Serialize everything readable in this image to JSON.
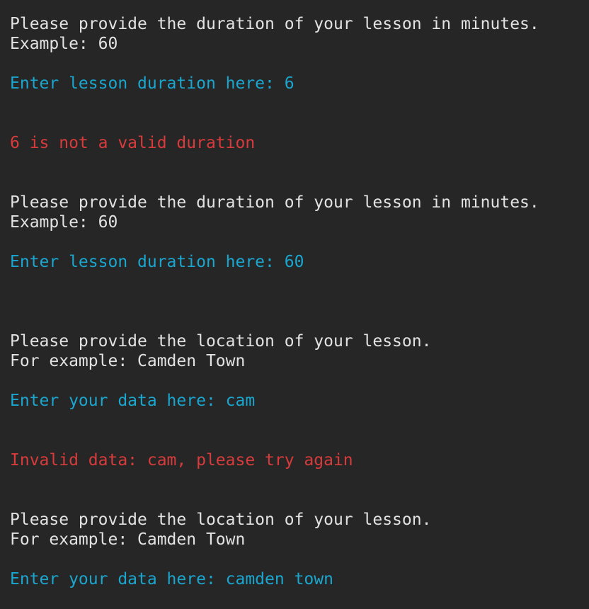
{
  "terminal": {
    "colors": {
      "background": "#262626",
      "text": "#e2e2e2",
      "input": "#1aa6cf",
      "error": "#d83b3b"
    },
    "lines": [
      "Please provide the duration of your lesson in minutes.",
      "Example: 60",
      "Enter lesson duration here: 6",
      "6 is not a valid duration",
      "Please provide the duration of your lesson in minutes.",
      "Example: 60",
      "Enter lesson duration here: 60",
      "Please provide the location of your lesson.",
      "For example: Camden Town",
      "Enter your data here: cam",
      "Invalid data: cam, please try again",
      "Please provide the location of your lesson.",
      "For example: Camden Town",
      "Enter your data here: camden town"
    ]
  }
}
